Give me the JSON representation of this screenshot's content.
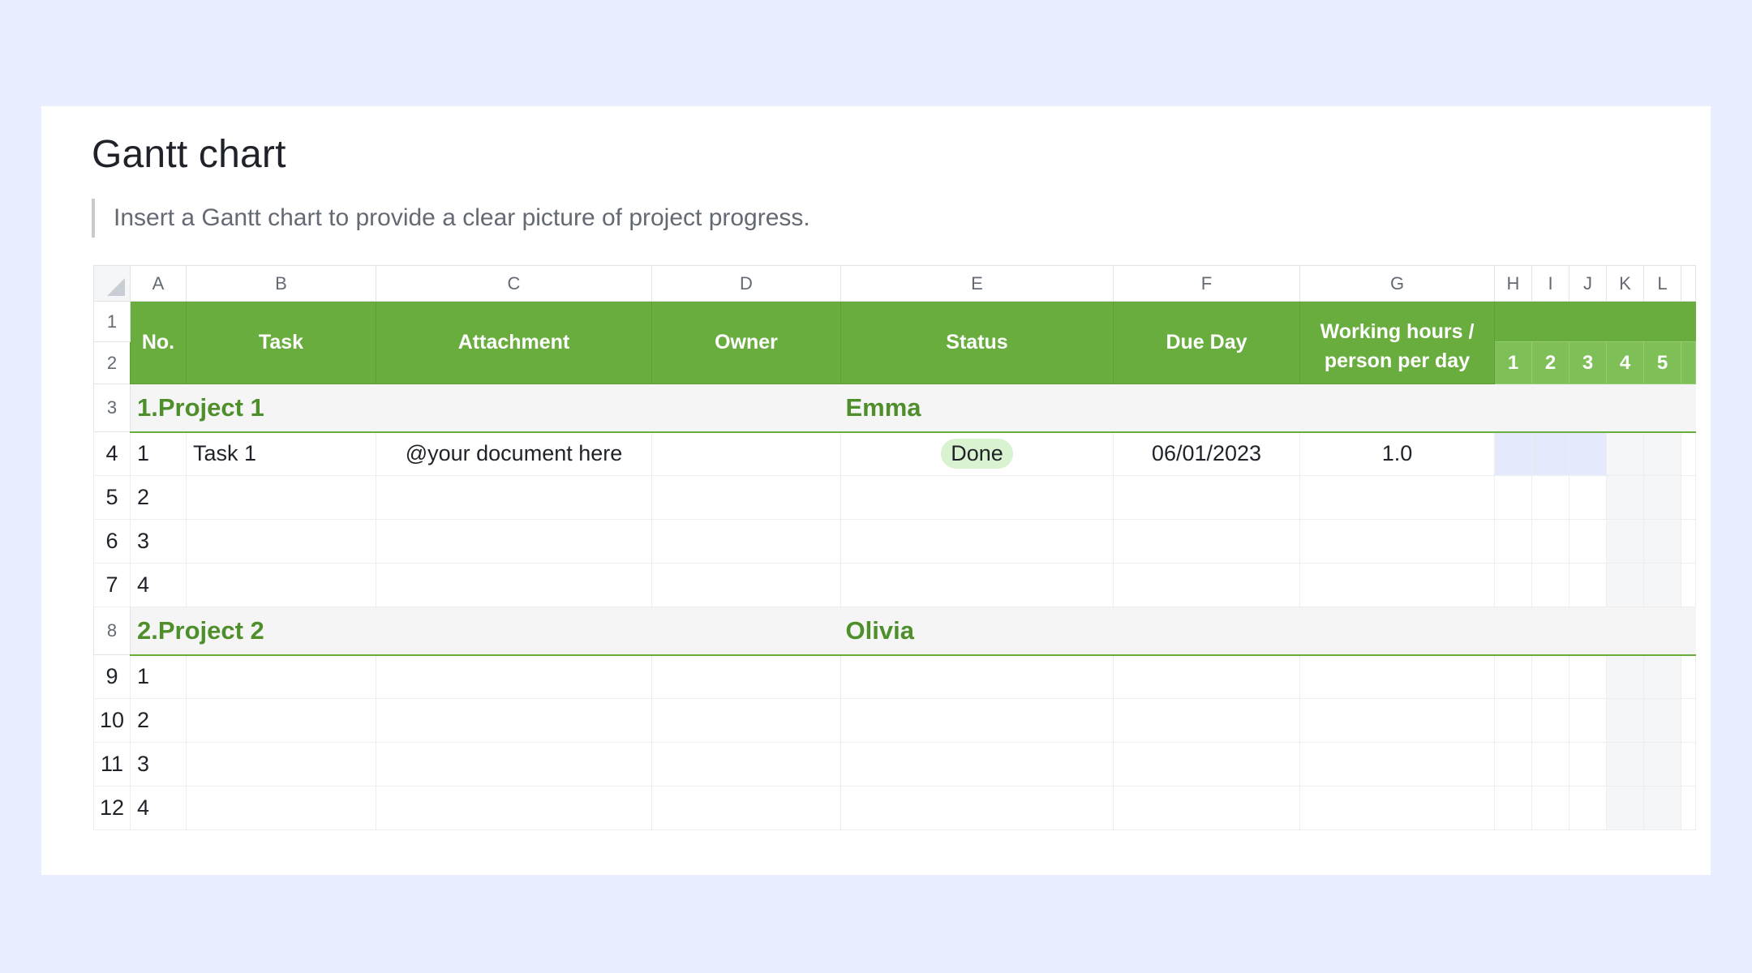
{
  "doc": {
    "title": "Gantt chart",
    "quote": "Insert a Gantt chart to provide a clear picture of project progress."
  },
  "columns": [
    "A",
    "B",
    "C",
    "D",
    "E",
    "F",
    "G",
    "H",
    "I",
    "J",
    "K",
    "L"
  ],
  "row_numbers": [
    "1",
    "2",
    "3",
    "4",
    "5",
    "6",
    "7",
    "8",
    "9",
    "10",
    "11",
    "12"
  ],
  "header": {
    "no": "No.",
    "task": "Task",
    "attachment": "Attachment",
    "owner": "Owner",
    "status": "Status",
    "due_day": "Due Day",
    "working_hours": "Working hours / person per day",
    "days": [
      "1",
      "2",
      "3",
      "4",
      "5"
    ]
  },
  "projects": [
    {
      "name": "1.Project 1",
      "owner": "Emma",
      "tasks": [
        {
          "no": "1",
          "task": "Task 1",
          "attachment": "@your document here",
          "status": "Done",
          "due": "06/01/2023",
          "hours": "1.0"
        },
        {
          "no": "2"
        },
        {
          "no": "3"
        },
        {
          "no": "4"
        }
      ]
    },
    {
      "name": "2.Project 2",
      "owner": "Olivia",
      "tasks": [
        {
          "no": "1"
        },
        {
          "no": "2"
        },
        {
          "no": "3"
        },
        {
          "no": "4"
        }
      ]
    }
  ],
  "colors": {
    "header_green": "#6aad3f",
    "day_green": "#7fbf57",
    "project_text": "#4e8f2c",
    "status_done": "#d9f2cf",
    "gantt_bar": "#e4e9fc",
    "page_bg": "#e8eefe"
  },
  "icons": {
    "corner": "select-all-triangle-icon"
  }
}
